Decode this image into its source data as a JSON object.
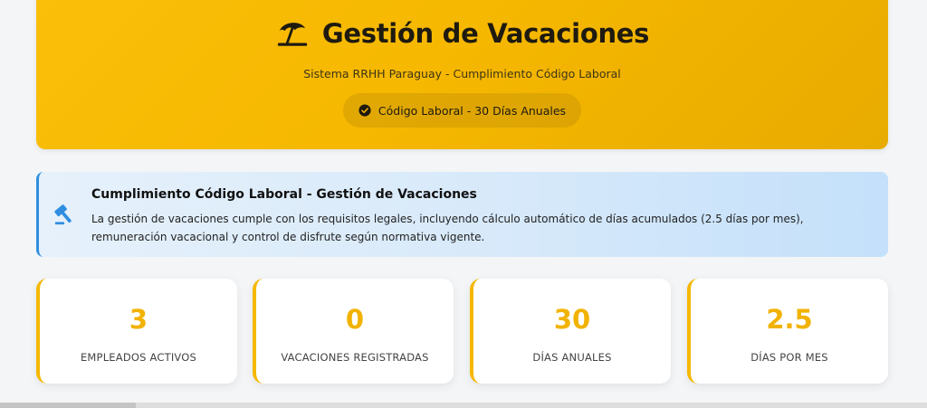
{
  "header": {
    "title": "Gestión de Vacaciones",
    "subtitle": "Sistema RRHH Paraguay - Cumplimiento Código Laboral",
    "badge": "Código Laboral - 30 Días Anuales",
    "title_icon": "beach-umbrella-icon",
    "badge_icon": "check-circle-icon"
  },
  "compliance": {
    "title": "Cumplimiento Código Laboral - Gestión de Vacaciones",
    "text": "La gestión de vacaciones cumple con los requisitos legales, incluyendo cálculo automático de días acumulados (2.5 días por mes), remuneración vacacional y control de disfrute según normativa vigente.",
    "icon": "gavel-icon"
  },
  "stats": [
    {
      "value": "3",
      "label": "EMPLEADOS ACTIVOS"
    },
    {
      "value": "0",
      "label": "VACACIONES REGISTRADAS"
    },
    {
      "value": "30",
      "label": "DÍAS ANUALES"
    },
    {
      "value": "2.5",
      "label": "DÍAS POR MES"
    }
  ],
  "colors": {
    "accent": "#f5b800",
    "info": "#2f8ee0"
  }
}
